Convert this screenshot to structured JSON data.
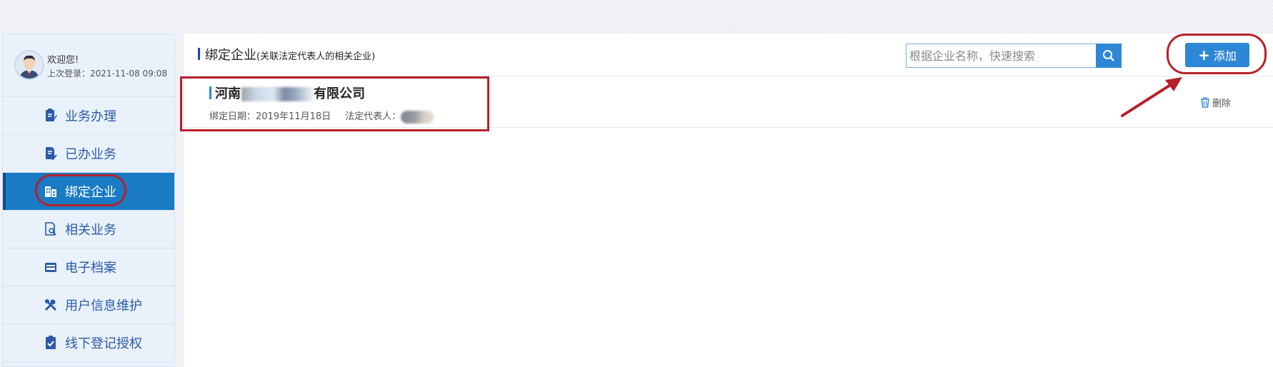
{
  "user": {
    "welcome": "欢迎您!",
    "last_login": "上次登录：2021-11-08 09:08"
  },
  "sidebar": {
    "items": [
      {
        "label": "业务办理",
        "icon": "clipboard-edit-icon"
      },
      {
        "label": "已办业务",
        "icon": "document-check-icon"
      },
      {
        "label": "绑定企业",
        "icon": "building-icon",
        "active": true
      },
      {
        "label": "相关业务",
        "icon": "document-search-icon"
      },
      {
        "label": "电子档案",
        "icon": "archive-box-icon"
      },
      {
        "label": "用户信息维护",
        "icon": "tools-icon"
      },
      {
        "label": "线下登记授权",
        "icon": "clipboard-check-icon"
      }
    ]
  },
  "header": {
    "title": "绑定企业",
    "subtitle": "(关联法定代表人的相关企业)",
    "search_placeholder": "根据企业名称，快速搜索",
    "add_label": "添加"
  },
  "companies": [
    {
      "name_prefix": "河南",
      "name_suffix": "有限公司",
      "date_label": "绑定日期：2019年11月18日",
      "rep_label": "法定代表人：",
      "delete_label": "删除"
    }
  ],
  "colors": {
    "primary": "#2e86d6",
    "sidebar_active": "#1a7ac4",
    "sidebar_text": "#2b5ba8",
    "annotation_red": "#b6212a"
  }
}
